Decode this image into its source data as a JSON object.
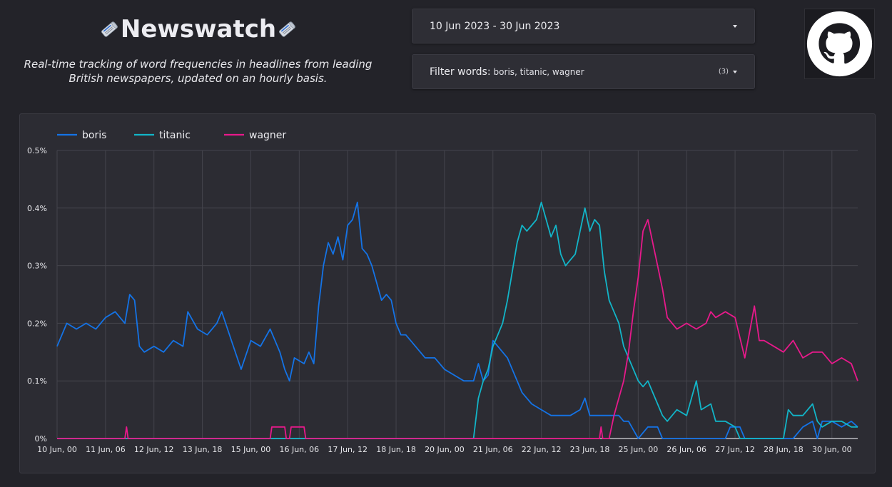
{
  "header": {
    "title": "Newswatch",
    "subtitle": "Real-time tracking of word frequencies in headlines from leading British newspapers, updated on an hourly basis.",
    "title_icon": "newspaper-roll-icon"
  },
  "date_range": {
    "value": "10 Jun 2023 - 30 Jun 2023",
    "icon": "chevron-down-icon"
  },
  "filter": {
    "label": "Filter words:",
    "values": "boris, titanic, wagner",
    "count": "(3)",
    "icon": "chevron-down-icon"
  },
  "github": {
    "icon": "github-icon"
  },
  "colors": {
    "background": "#232329",
    "panel": "#2c2c33",
    "boris": "#1473e6",
    "titanic": "#12b5c8",
    "wagner": "#e8198b"
  },
  "chart_data": {
    "type": "line",
    "title": "",
    "xlabel": "",
    "ylabel": "",
    "ylim": [
      0,
      0.5
    ],
    "y_unit": "%",
    "y_ticks": [
      "0%",
      "0.1%",
      "0.2%",
      "0.3%",
      "0.4%",
      "0.5%"
    ],
    "x_tick_labels": [
      "10 Jun, 00",
      "11 Jun, 06",
      "12 Jun, 12",
      "13 Jun, 18",
      "15 Jun, 00",
      "16 Jun, 06",
      "17 Jun, 12",
      "18 Jun, 18",
      "20 Jun, 00",
      "21 Jun, 06",
      "22 Jun, 12",
      "23 Jun, 18",
      "25 Jun, 00",
      "26 Jun, 06",
      "27 Jun, 12",
      "28 Jun, 18",
      "30 Jun, 00"
    ],
    "x_start": "10 Jun 2023, 00:00",
    "x_end": "30 Jun 2023, 16:00",
    "grid": true,
    "legend_position": "top-left",
    "series": [
      {
        "name": "boris",
        "color": "#1473e6",
        "points": [
          [
            "10 Jun, 00",
            0.16
          ],
          [
            "10 Jun, 06",
            0.2
          ],
          [
            "10 Jun, 12",
            0.19
          ],
          [
            "10 Jun, 18",
            0.2
          ],
          [
            "11 Jun, 00",
            0.19
          ],
          [
            "11 Jun, 06",
            0.21
          ],
          [
            "11 Jun, 12",
            0.22
          ],
          [
            "11 Jun, 18",
            0.2
          ],
          [
            "11 Jun, 21",
            0.25
          ],
          [
            "12 Jun, 00",
            0.24
          ],
          [
            "12 Jun, 03",
            0.16
          ],
          [
            "12 Jun, 06",
            0.15
          ],
          [
            "12 Jun, 12",
            0.16
          ],
          [
            "12 Jun, 18",
            0.15
          ],
          [
            "13 Jun, 00",
            0.17
          ],
          [
            "13 Jun, 06",
            0.16
          ],
          [
            "13 Jun, 09",
            0.22
          ],
          [
            "13 Jun, 15",
            0.19
          ],
          [
            "13 Jun, 21",
            0.18
          ],
          [
            "14 Jun, 03",
            0.2
          ],
          [
            "14 Jun, 06",
            0.22
          ],
          [
            "14 Jun, 12",
            0.17
          ],
          [
            "14 Jun, 18",
            0.12
          ],
          [
            "15 Jun, 00",
            0.17
          ],
          [
            "15 Jun, 06",
            0.16
          ],
          [
            "15 Jun, 12",
            0.19
          ],
          [
            "15 Jun, 18",
            0.15
          ],
          [
            "15 Jun, 21",
            0.12
          ],
          [
            "16 Jun, 00",
            0.1
          ],
          [
            "16 Jun, 03",
            0.14
          ],
          [
            "16 Jun, 09",
            0.13
          ],
          [
            "16 Jun, 12",
            0.15
          ],
          [
            "16 Jun, 15",
            0.13
          ],
          [
            "16 Jun, 18",
            0.23
          ],
          [
            "16 Jun, 21",
            0.3
          ],
          [
            "17 Jun, 00",
            0.34
          ],
          [
            "17 Jun, 03",
            0.32
          ],
          [
            "17 Jun, 06",
            0.35
          ],
          [
            "17 Jun, 09",
            0.31
          ],
          [
            "17 Jun, 12",
            0.37
          ],
          [
            "17 Jun, 15",
            0.38
          ],
          [
            "17 Jun, 18",
            0.41
          ],
          [
            "17 Jun, 21",
            0.33
          ],
          [
            "18 Jun, 00",
            0.32
          ],
          [
            "18 Jun, 03",
            0.3
          ],
          [
            "18 Jun, 06",
            0.27
          ],
          [
            "18 Jun, 09",
            0.24
          ],
          [
            "18 Jun, 12",
            0.25
          ],
          [
            "18 Jun, 15",
            0.24
          ],
          [
            "18 Jun, 18",
            0.2
          ],
          [
            "18 Jun, 21",
            0.18
          ],
          [
            "19 Jun, 00",
            0.18
          ],
          [
            "19 Jun, 06",
            0.16
          ],
          [
            "19 Jun, 12",
            0.14
          ],
          [
            "19 Jun, 18",
            0.14
          ],
          [
            "20 Jun, 00",
            0.12
          ],
          [
            "20 Jun, 06",
            0.11
          ],
          [
            "20 Jun, 12",
            0.1
          ],
          [
            "20 Jun, 18",
            0.1
          ],
          [
            "20 Jun, 21",
            0.13
          ],
          [
            "21 Jun, 00",
            0.1
          ],
          [
            "21 Jun, 03",
            0.11
          ],
          [
            "21 Jun, 06",
            0.17
          ],
          [
            "21 Jun, 09",
            0.16
          ],
          [
            "21 Jun, 15",
            0.14
          ],
          [
            "21 Jun, 21",
            0.1
          ],
          [
            "22 Jun, 00",
            0.08
          ],
          [
            "22 Jun, 06",
            0.06
          ],
          [
            "22 Jun, 12",
            0.05
          ],
          [
            "22 Jun, 18",
            0.04
          ],
          [
            "23 Jun, 00",
            0.04
          ],
          [
            "23 Jun, 06",
            0.04
          ],
          [
            "23 Jun, 12",
            0.05
          ],
          [
            "23 Jun, 15",
            0.07
          ],
          [
            "23 Jun, 18",
            0.04
          ],
          [
            "24 Jun, 00",
            0.04
          ],
          [
            "24 Jun, 06",
            0.04
          ],
          [
            "24 Jun, 12",
            0.04
          ],
          [
            "24 Jun, 15",
            0.03
          ],
          [
            "24 Jun, 18",
            0.03
          ],
          [
            "25 Jun, 00",
            0.0
          ],
          [
            "25 Jun, 06",
            0.02
          ],
          [
            "25 Jun, 12",
            0.02
          ],
          [
            "25 Jun, 15",
            0.0
          ],
          [
            "26 Jun, 00",
            0.0
          ],
          [
            "27 Jun, 00",
            0.0
          ],
          [
            "27 Jun, 06",
            0.0
          ],
          [
            "27 Jun, 09",
            0.02
          ],
          [
            "27 Jun, 15",
            0.02
          ],
          [
            "27 Jun, 18",
            0.0
          ],
          [
            "28 Jun, 00",
            0.0
          ],
          [
            "29 Jun, 00",
            0.0
          ],
          [
            "29 Jun, 06",
            0.02
          ],
          [
            "29 Jun, 12",
            0.03
          ],
          [
            "29 Jun, 15",
            0.0
          ],
          [
            "29 Jun, 18",
            0.03
          ],
          [
            "30 Jun, 00",
            0.03
          ],
          [
            "30 Jun, 06",
            0.02
          ],
          [
            "30 Jun, 12",
            0.03
          ],
          [
            "30 Jun, 16",
            0.02
          ]
        ]
      },
      {
        "name": "titanic",
        "color": "#12b5c8",
        "points": [
          [
            "10 Jun, 00",
            0.0
          ],
          [
            "20 Jun, 18",
            0.0
          ],
          [
            "20 Jun, 21",
            0.07
          ],
          [
            "21 Jun, 00",
            0.1
          ],
          [
            "21 Jun, 03",
            0.12
          ],
          [
            "21 Jun, 06",
            0.16
          ],
          [
            "21 Jun, 09",
            0.18
          ],
          [
            "21 Jun, 12",
            0.2
          ],
          [
            "21 Jun, 15",
            0.24
          ],
          [
            "21 Jun, 18",
            0.29
          ],
          [
            "21 Jun, 21",
            0.34
          ],
          [
            "22 Jun, 00",
            0.37
          ],
          [
            "22 Jun, 03",
            0.36
          ],
          [
            "22 Jun, 06",
            0.37
          ],
          [
            "22 Jun, 09",
            0.38
          ],
          [
            "22 Jun, 12",
            0.41
          ],
          [
            "22 Jun, 15",
            0.38
          ],
          [
            "22 Jun, 18",
            0.35
          ],
          [
            "22 Jun, 21",
            0.37
          ],
          [
            "23 Jun, 00",
            0.32
          ],
          [
            "23 Jun, 03",
            0.3
          ],
          [
            "23 Jun, 06",
            0.31
          ],
          [
            "23 Jun, 09",
            0.32
          ],
          [
            "23 Jun, 12",
            0.36
          ],
          [
            "23 Jun, 15",
            0.4
          ],
          [
            "23 Jun, 18",
            0.36
          ],
          [
            "23 Jun, 21",
            0.38
          ],
          [
            "24 Jun, 00",
            0.37
          ],
          [
            "24 Jun, 03",
            0.29
          ],
          [
            "24 Jun, 06",
            0.24
          ],
          [
            "24 Jun, 09",
            0.22
          ],
          [
            "24 Jun, 12",
            0.2
          ],
          [
            "24 Jun, 15",
            0.16
          ],
          [
            "24 Jun, 18",
            0.14
          ],
          [
            "24 Jun, 21",
            0.12
          ],
          [
            "25 Jun, 00",
            0.1
          ],
          [
            "25 Jun, 03",
            0.09
          ],
          [
            "25 Jun, 06",
            0.1
          ],
          [
            "25 Jun, 09",
            0.08
          ],
          [
            "25 Jun, 12",
            0.06
          ],
          [
            "25 Jun, 15",
            0.04
          ],
          [
            "25 Jun, 18",
            0.03
          ],
          [
            "26 Jun, 00",
            0.05
          ],
          [
            "26 Jun, 06",
            0.04
          ],
          [
            "26 Jun, 12",
            0.1
          ],
          [
            "26 Jun, 15",
            0.05
          ],
          [
            "26 Jun, 21",
            0.06
          ],
          [
            "27 Jun, 00",
            0.03
          ],
          [
            "27 Jun, 06",
            0.03
          ],
          [
            "27 Jun, 12",
            0.02
          ],
          [
            "27 Jun, 15",
            0.0
          ],
          [
            "28 Jun, 18",
            0.0
          ],
          [
            "28 Jun, 21",
            0.05
          ],
          [
            "29 Jun, 00",
            0.04
          ],
          [
            "29 Jun, 06",
            0.04
          ],
          [
            "29 Jun, 12",
            0.06
          ],
          [
            "29 Jun, 15",
            0.03
          ],
          [
            "29 Jun, 18",
            0.02
          ],
          [
            "30 Jun, 00",
            0.03
          ],
          [
            "30 Jun, 06",
            0.03
          ],
          [
            "30 Jun, 12",
            0.02
          ],
          [
            "30 Jun, 16",
            0.02
          ]
        ]
      },
      {
        "name": "wagner",
        "color": "#e8198b",
        "points": [
          [
            "10 Jun, 00",
            0.0
          ],
          [
            "11 Jun, 18",
            0.0
          ],
          [
            "11 Jun, 19",
            0.02
          ],
          [
            "11 Jun, 20",
            0.0
          ],
          [
            "15 Jun, 12",
            0.0
          ],
          [
            "15 Jun, 13",
            0.02
          ],
          [
            "15 Jun, 21",
            0.02
          ],
          [
            "15 Jun, 22",
            0.0
          ],
          [
            "16 Jun, 00",
            0.0
          ],
          [
            "16 Jun, 01",
            0.02
          ],
          [
            "16 Jun, 09",
            0.02
          ],
          [
            "16 Jun, 10",
            0.0
          ],
          [
            "24 Jun, 00",
            0.0
          ],
          [
            "24 Jun, 01",
            0.02
          ],
          [
            "24 Jun, 02",
            0.0
          ],
          [
            "24 Jun, 06",
            0.0
          ],
          [
            "24 Jun, 09",
            0.04
          ],
          [
            "24 Jun, 12",
            0.07
          ],
          [
            "24 Jun, 15",
            0.1
          ],
          [
            "24 Jun, 18",
            0.15
          ],
          [
            "24 Jun, 21",
            0.22
          ],
          [
            "25 Jun, 00",
            0.28
          ],
          [
            "25 Jun, 03",
            0.36
          ],
          [
            "25 Jun, 06",
            0.38
          ],
          [
            "25 Jun, 09",
            0.34
          ],
          [
            "25 Jun, 12",
            0.3
          ],
          [
            "25 Jun, 15",
            0.26
          ],
          [
            "25 Jun, 18",
            0.21
          ],
          [
            "26 Jun, 00",
            0.19
          ],
          [
            "26 Jun, 06",
            0.2
          ],
          [
            "26 Jun, 12",
            0.19
          ],
          [
            "26 Jun, 18",
            0.2
          ],
          [
            "26 Jun, 21",
            0.22
          ],
          [
            "27 Jun, 00",
            0.21
          ],
          [
            "27 Jun, 06",
            0.22
          ],
          [
            "27 Jun, 12",
            0.21
          ],
          [
            "27 Jun, 18",
            0.14
          ],
          [
            "28 Jun, 00",
            0.23
          ],
          [
            "28 Jun, 03",
            0.17
          ],
          [
            "28 Jun, 06",
            0.17
          ],
          [
            "28 Jun, 12",
            0.16
          ],
          [
            "28 Jun, 18",
            0.15
          ],
          [
            "29 Jun, 00",
            0.17
          ],
          [
            "29 Jun, 06",
            0.14
          ],
          [
            "29 Jun, 12",
            0.15
          ],
          [
            "29 Jun, 18",
            0.15
          ],
          [
            "30 Jun, 00",
            0.13
          ],
          [
            "30 Jun, 06",
            0.14
          ],
          [
            "30 Jun, 12",
            0.13
          ],
          [
            "30 Jun, 16",
            0.1
          ]
        ]
      }
    ]
  }
}
